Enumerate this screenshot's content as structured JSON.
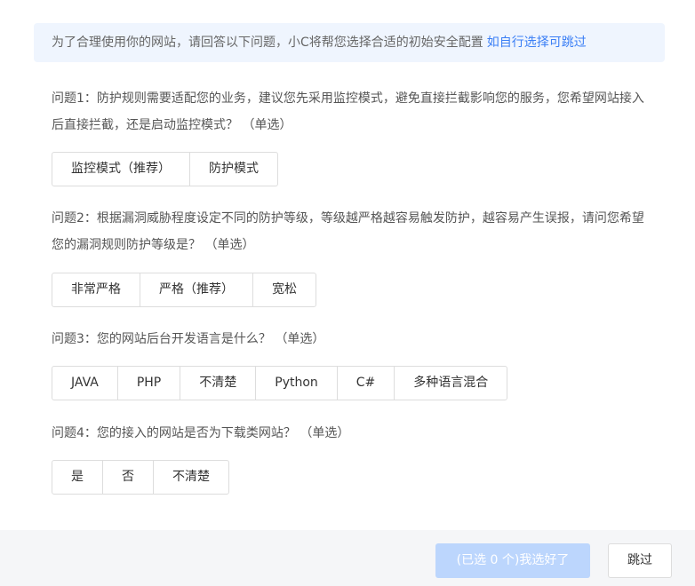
{
  "banner": {
    "text": "为了合理使用你的网站，请回答以下问题，小C将帮您选择合适的初始安全配置",
    "link": "如自行选择可跳过"
  },
  "questions": [
    {
      "text": "问题1：防护规则需要适配您的业务，建议您先采用监控模式，避免直接拦截影响您的服务，您希望网站接入后直接拦截，还是启动监控模式？ （单选）",
      "options": [
        "监控模式（推荐）",
        "防护模式"
      ]
    },
    {
      "text": "问题2：根据漏洞威胁程度设定不同的防护等级，等级越严格越容易触发防护，越容易产生误报，请问您希望您的漏洞规则防护等级是？ （单选）",
      "options": [
        "非常严格",
        "严格（推荐）",
        "宽松"
      ]
    },
    {
      "text": "问题3：您的网站后台开发语言是什么？ （单选）",
      "options": [
        "JAVA",
        "PHP",
        "不清楚",
        "Python",
        "C#",
        "多种语言混合"
      ]
    },
    {
      "text": "问题4：您的接入的网站是否为下载类网站？ （单选）",
      "options": [
        "是",
        "否",
        "不清楚"
      ]
    }
  ],
  "footer": {
    "confirm_label": "(已选 0 个)我选好了",
    "skip_label": "跳过"
  }
}
